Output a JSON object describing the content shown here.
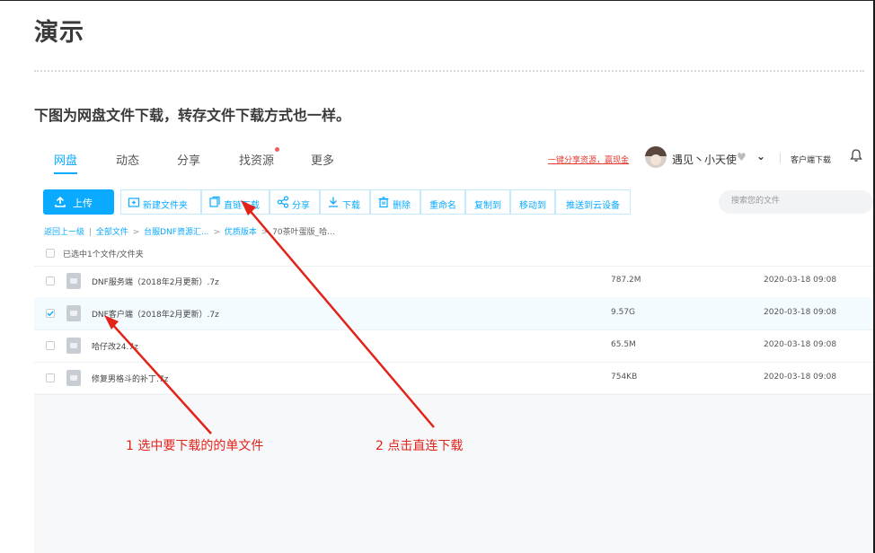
{
  "page": {
    "title": "演示",
    "intro": "下图为网盘文件下载，转存文件下载方式也一样。"
  },
  "nav": {
    "tabs": [
      {
        "label": "网盘",
        "active": true
      },
      {
        "label": "动态"
      },
      {
        "label": "分享"
      },
      {
        "label": "找资源",
        "has_red_dot": true
      },
      {
        "label": "更多"
      }
    ],
    "promo_link": "一键分享资源，赢现金",
    "username": "遇见丶小天使",
    "client_download": "客户端下载"
  },
  "toolbar": {
    "upload": "上传",
    "new_folder": "新建文件夹",
    "direct_download": "直链下载",
    "share": "分享",
    "download": "下载",
    "delete": "删除",
    "rename": "重命名",
    "copy_to": "复制到",
    "move_to": "移动到",
    "push_to_cloud": "推送到云设备",
    "search_placeholder": "搜索您的文件"
  },
  "breadcrumb": {
    "back": "返回上一级",
    "all_files": "全部文件",
    "level1": "台服DNF資源汇...",
    "level2": "优质版本",
    "level3": "70茶叶蛋版_哈..."
  },
  "selection": {
    "text": "已选中1个文件/文件夹"
  },
  "files": [
    {
      "name": "DNF服务端（2018年2月更新）.7z",
      "size": "787.2M",
      "date": "2020-03-18 09:08",
      "checked": false
    },
    {
      "name": "DNF客户端（2018年2月更新）.7z",
      "size": "9.57G",
      "date": "2020-03-18 09:08",
      "checked": true
    },
    {
      "name": "哈仔改24.7z",
      "size": "65.5M",
      "date": "2020-03-18 09:08",
      "checked": false
    },
    {
      "name": "修复男格斗的补丁.7z",
      "size": "754KB",
      "date": "2020-03-18 09:08",
      "checked": false
    }
  ],
  "annotations": {
    "step1": "1  选中要下载的的单文件",
    "step2": "2 点击直连下载"
  },
  "colors": {
    "accent": "#09aaff",
    "annotation_red": "#e32219"
  }
}
